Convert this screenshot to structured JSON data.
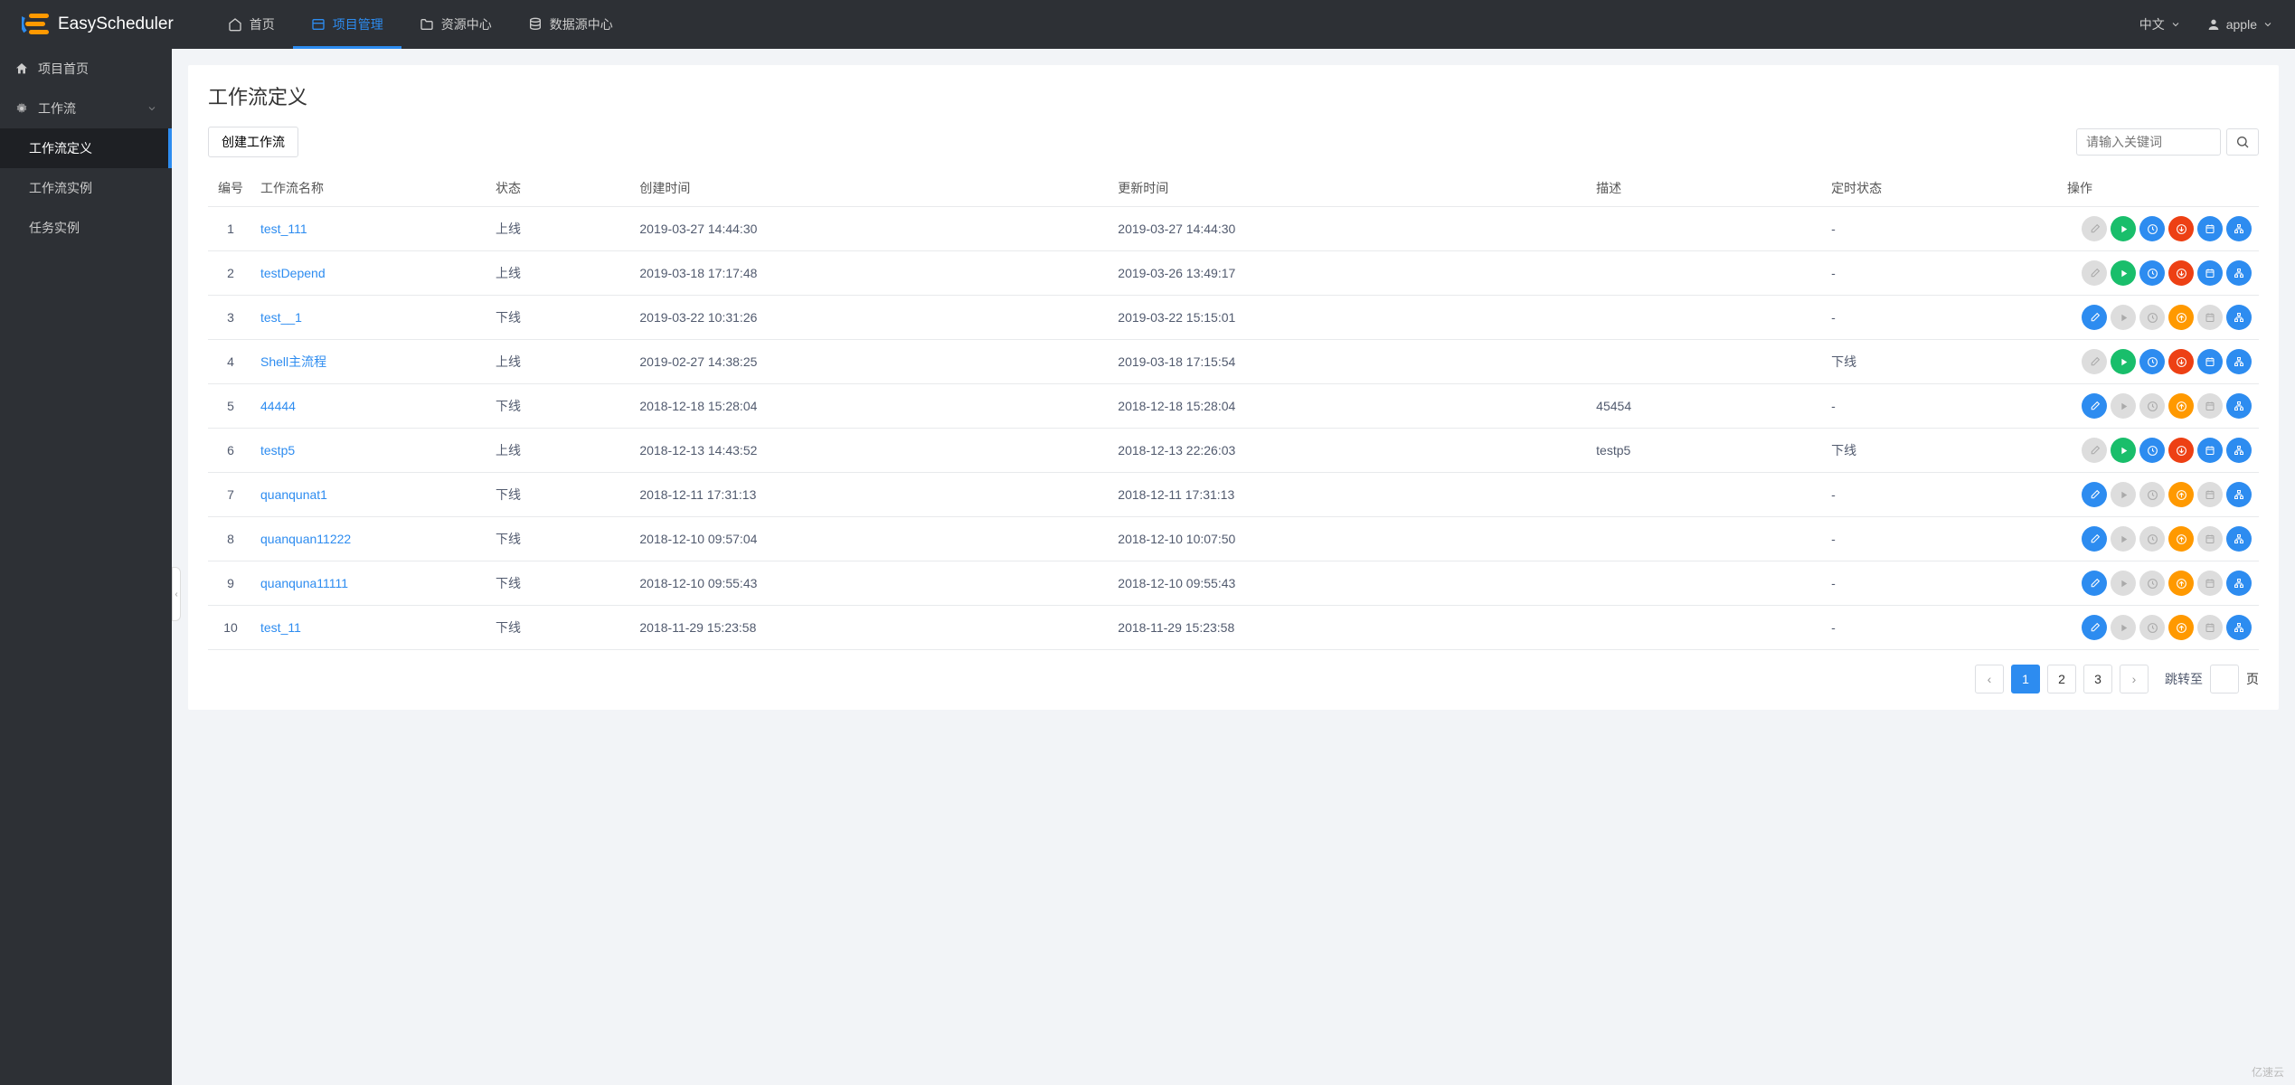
{
  "brand": "EasyScheduler",
  "nav": {
    "home": "首页",
    "project": "项目管理",
    "resource": "资源中心",
    "datasource": "数据源中心"
  },
  "navRight": {
    "lang": "中文",
    "user": "apple"
  },
  "sidebar": {
    "project_home": "项目首页",
    "workflow": "工作流",
    "workflow_def": "工作流定义",
    "workflow_inst": "工作流实例",
    "task_inst": "任务实例"
  },
  "page": {
    "title": "工作流定义",
    "create_btn": "创建工作流",
    "search_placeholder": "请输入关键词"
  },
  "columns": {
    "id": "编号",
    "name": "工作流名称",
    "status": "状态",
    "create_time": "创建时间",
    "update_time": "更新时间",
    "desc": "描述",
    "timer_status": "定时状态",
    "ops": "操作"
  },
  "status_online": "上线",
  "status_offline": "下线",
  "rows": [
    {
      "id": "1",
      "name": "test_111",
      "status": "上线",
      "created": "2019-03-27 14:44:30",
      "updated": "2019-03-27 14:44:30",
      "desc": "",
      "timer": "-",
      "mode": "online"
    },
    {
      "id": "2",
      "name": "testDepend",
      "status": "上线",
      "created": "2019-03-18 17:17:48",
      "updated": "2019-03-26 13:49:17",
      "desc": "",
      "timer": "-",
      "mode": "online"
    },
    {
      "id": "3",
      "name": "test__1",
      "status": "下线",
      "created": "2019-03-22 10:31:26",
      "updated": "2019-03-22 15:15:01",
      "desc": "",
      "timer": "-",
      "mode": "offline"
    },
    {
      "id": "4",
      "name": "Shell主流程",
      "status": "上线",
      "created": "2019-02-27 14:38:25",
      "updated": "2019-03-18 17:15:54",
      "desc": "",
      "timer": "下线",
      "mode": "online"
    },
    {
      "id": "5",
      "name": "44444",
      "status": "下线",
      "created": "2018-12-18 15:28:04",
      "updated": "2018-12-18 15:28:04",
      "desc": "45454",
      "timer": "-",
      "mode": "offline"
    },
    {
      "id": "6",
      "name": "testp5",
      "status": "上线",
      "created": "2018-12-13 14:43:52",
      "updated": "2018-12-13 22:26:03",
      "desc": "testp5",
      "timer": "下线",
      "mode": "online"
    },
    {
      "id": "7",
      "name": "quanqunat1",
      "status": "下线",
      "created": "2018-12-11 17:31:13",
      "updated": "2018-12-11 17:31:13",
      "desc": "",
      "timer": "-",
      "mode": "offline"
    },
    {
      "id": "8",
      "name": "quanquan11222",
      "status": "下线",
      "created": "2018-12-10 09:57:04",
      "updated": "2018-12-10 10:07:50",
      "desc": "",
      "timer": "-",
      "mode": "offline"
    },
    {
      "id": "9",
      "name": "quanquna11111",
      "status": "下线",
      "created": "2018-12-10 09:55:43",
      "updated": "2018-12-10 09:55:43",
      "desc": "",
      "timer": "-",
      "mode": "offline"
    },
    {
      "id": "10",
      "name": "test_11",
      "status": "下线",
      "created": "2018-11-29 15:23:58",
      "updated": "2018-11-29 15:23:58",
      "desc": "",
      "timer": "-",
      "mode": "offline"
    }
  ],
  "pagination": {
    "pages": [
      "1",
      "2",
      "3"
    ],
    "jump_label": "跳转至",
    "page_suffix": "页"
  },
  "watermark": "亿速云"
}
